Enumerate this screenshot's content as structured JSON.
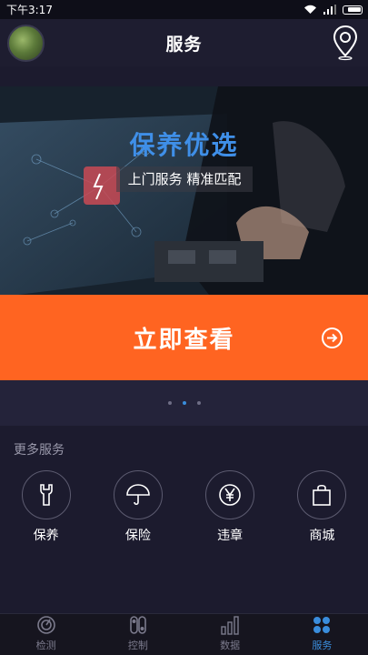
{
  "status_bar": {
    "time": "下午3:17"
  },
  "header": {
    "title": "服务"
  },
  "banner": {
    "title": "保养优选",
    "subtitle": "上门服务 精准匹配",
    "cta_label": "立即查看",
    "active_dot": 1,
    "dot_count": 3
  },
  "more_services": {
    "title": "更多服务",
    "items": [
      {
        "label": "保养",
        "icon": "wrench-icon"
      },
      {
        "label": "保险",
        "icon": "umbrella-icon"
      },
      {
        "label": "违章",
        "icon": "yen-icon"
      },
      {
        "label": "商城",
        "icon": "shopping-bag-icon"
      }
    ]
  },
  "tabbar": {
    "items": [
      {
        "label": "检测",
        "icon": "detect-icon",
        "active": false
      },
      {
        "label": "控制",
        "icon": "control-icon",
        "active": false
      },
      {
        "label": "数据",
        "icon": "data-bars-icon",
        "active": false
      },
      {
        "label": "服务",
        "icon": "service-grid-icon",
        "active": true
      }
    ]
  },
  "colors": {
    "accent_orange": "#ff6421",
    "accent_blue": "#3a8ddc",
    "background": "#1c1b2e"
  }
}
